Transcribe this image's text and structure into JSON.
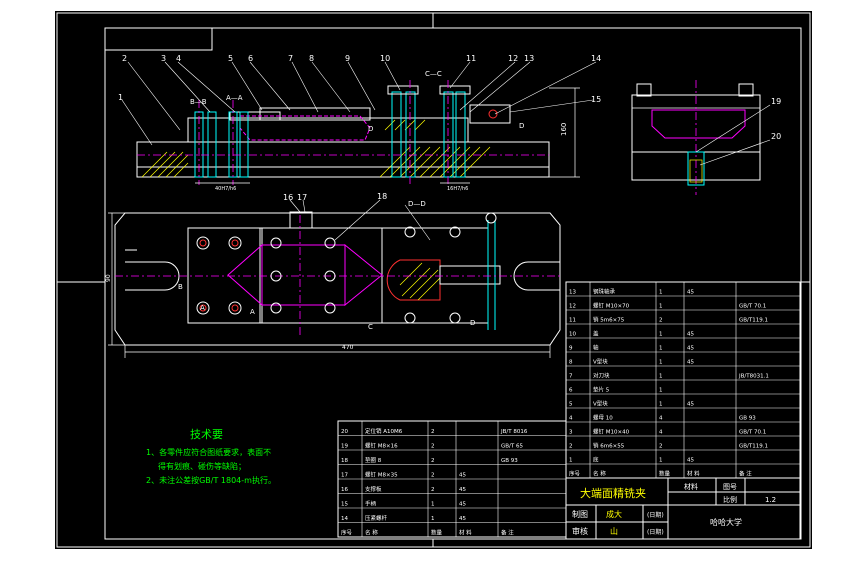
{
  "colors": {
    "background": "#000000",
    "outer_bg": "#ffffff",
    "frame": "#ffffff",
    "line_cyan": "#00ffff",
    "line_white": "#ffffff",
    "line_red": "#ff3030",
    "line_magenta": "#ff00ff",
    "line_yellow": "#ffff00",
    "hatch": "#ffff00",
    "text_green": "#00ff00",
    "text_yellow": "#ffff00"
  },
  "callouts": {
    "front_view": [
      "1",
      "2",
      "3",
      "4",
      "5",
      "6",
      "7",
      "8",
      "9",
      "10",
      "11",
      "12",
      "13",
      "14",
      "15"
    ],
    "side_view": [
      "19",
      "20"
    ],
    "top_view": [
      "16",
      "17",
      "18"
    ]
  },
  "section_marks": {
    "b_b": "B—B",
    "a_a": "A—A",
    "c_c": "C—C",
    "d_d": "D—D",
    "b": "B",
    "a": "A",
    "c": "C",
    "d": "D"
  },
  "dimensions": {
    "front_height": "160",
    "front_small_1": "40H7/h6",
    "front_small_2": "16H7/h6",
    "top_width": "470",
    "top_height": "90"
  },
  "tech_requirements": {
    "title": "技术要",
    "line1": "1、各零件应符合图纸要求，表面不",
    "line2": "得有划痕、碰伤等缺陷；",
    "line3": "2、未注公差按GB/T 1804-m执行。"
  },
  "parts_right": [
    {
      "no": "13",
      "name": "钢珠轴承",
      "qty": "1",
      "mat": "45",
      "std": ""
    },
    {
      "no": "12",
      "name": "螺钉 M10×70",
      "qty": "1",
      "mat": "",
      "std": "GB/T 70.1"
    },
    {
      "no": "11",
      "name": "销 5m6×75",
      "qty": "2",
      "mat": "",
      "std": "GB/T119.1"
    },
    {
      "no": "10",
      "name": "盖",
      "qty": "1",
      "mat": "45",
      "std": ""
    },
    {
      "no": "9",
      "name": "轴",
      "qty": "1",
      "mat": "45",
      "std": ""
    },
    {
      "no": "8",
      "name": "V型块",
      "qty": "1",
      "mat": "45",
      "std": ""
    },
    {
      "no": "7",
      "name": "对刀块",
      "qty": "1",
      "mat": "",
      "std": "JB/T8031.1"
    },
    {
      "no": "6",
      "name": "垫片 5",
      "qty": "1",
      "mat": "",
      "std": ""
    },
    {
      "no": "5",
      "name": "V型块",
      "qty": "1",
      "mat": "45",
      "std": ""
    },
    {
      "no": "4",
      "name": "螺母 10",
      "qty": "4",
      "mat": "",
      "std": "GB 93"
    },
    {
      "no": "3",
      "name": "螺钉 M10×40",
      "qty": "4",
      "mat": "",
      "std": "GB/T 70.1"
    },
    {
      "no": "2",
      "name": "销 6m6×55",
      "qty": "2",
      "mat": "",
      "std": "GB/T119.1"
    },
    {
      "no": "1",
      "name": "底",
      "qty": "1",
      "mat": "45",
      "std": ""
    }
  ],
  "parts_right_header": {
    "no": "序号",
    "name": "名 称",
    "qty": "数量",
    "mat": "材 料",
    "std": "备 注"
  },
  "parts_left": [
    {
      "no": "20",
      "name": "定位销 A10M6",
      "qty": "2",
      "std": "JB/T 8016"
    },
    {
      "no": "19",
      "name": "螺钉 M8×16",
      "qty": "2",
      "std": "GB/T 65"
    },
    {
      "no": "18",
      "name": "垫圈 8",
      "qty": "2",
      "std": "GB 93"
    },
    {
      "no": "17",
      "name": "螺钉 M8×35",
      "qty": "2",
      "mat": "45",
      "std": ""
    },
    {
      "no": "16",
      "name": "支撑板",
      "qty": "2",
      "mat": "45",
      "std": ""
    },
    {
      "no": "15",
      "name": "手柄",
      "qty": "1",
      "mat": "45",
      "std": ""
    },
    {
      "no": "14",
      "name": "压紧螺杆",
      "qty": "1",
      "mat": "45",
      "std": ""
    }
  ],
  "parts_left_header": {
    "no": "序号",
    "name": "名 称",
    "qty": "数量",
    "mat": "材 料",
    "std": "备 注"
  },
  "title_block": {
    "drawing_title": "大端面精铣夹",
    "material_label": "材料",
    "drawing_no_label": "图号",
    "scale_label": "比例",
    "scale_value": "1.2",
    "drawn_label": "制图",
    "drawn_name": "成大",
    "checked_label": "审核",
    "checked_name": "山",
    "date1": "(日期)",
    "date2": "(日期)",
    "school": "哈哈大学"
  }
}
